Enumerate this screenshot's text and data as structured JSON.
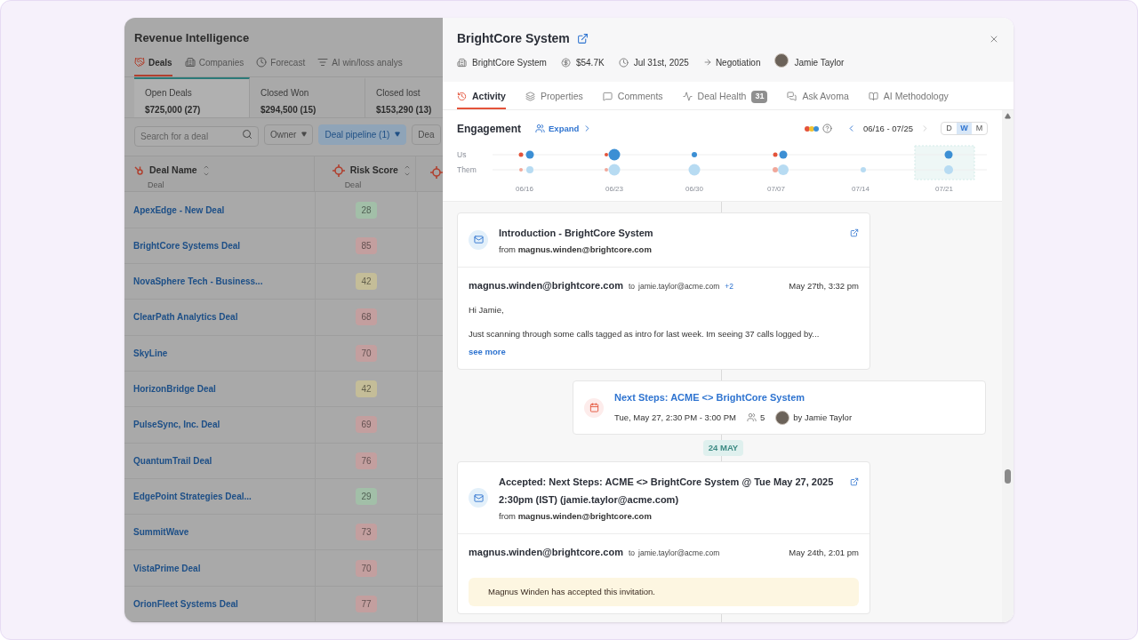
{
  "app": {
    "title": "Revenue Intelligence",
    "tabs": [
      {
        "label": "Deals",
        "selected": true
      },
      {
        "label": "Companies",
        "selected": false
      },
      {
        "label": "Forecast",
        "selected": false
      },
      {
        "label": "AI win/loss analys",
        "selected": false
      }
    ],
    "stats": [
      {
        "label": "Open Deals",
        "value": "$725,000 (27)",
        "selected": true
      },
      {
        "label": "Closed Won",
        "value": "$294,500 (15)",
        "selected": false
      },
      {
        "label": "Closed lost",
        "value": "$153,290 (13)",
        "selected": false
      }
    ],
    "search": {
      "placeholder": "Search for a deal"
    },
    "filters": [
      {
        "label": "Owner",
        "active": false,
        "cut": false
      },
      {
        "label": "Deal pipeline (1)",
        "active": true,
        "cut": false
      },
      {
        "label": "Dea",
        "active": false,
        "cut": true
      }
    ],
    "table": {
      "columns": [
        {
          "title": "Deal Name",
          "subtitle": "Deal"
        },
        {
          "title": "Risk Score",
          "subtitle": "Deal"
        }
      ],
      "rows": [
        {
          "name": "ApexEdge - New Deal",
          "score": "28",
          "color": "#a2bfa8"
        },
        {
          "name": "BrightCore Systems Deal",
          "score": "85",
          "color": "#c39f9f"
        },
        {
          "name": "NovaSphere Tech - Business...",
          "score": "42",
          "color": "#c4bd98"
        },
        {
          "name": "ClearPath Analytics Deal",
          "score": "68",
          "color": "#c39f9f"
        },
        {
          "name": "SkyLine",
          "score": "70",
          "color": "#c39f9f"
        },
        {
          "name": "HorizonBridge Deal",
          "score": "42",
          "color": "#c4bd98"
        },
        {
          "name": "PulseSync, Inc. Deal",
          "score": "69",
          "color": "#c39f9f"
        },
        {
          "name": "QuantumTrail Deal",
          "score": "76",
          "color": "#c39f9f"
        },
        {
          "name": "EdgePoint Strategies Deal...",
          "score": "29",
          "color": "#a2bfa8"
        },
        {
          "name": "SummitWave",
          "score": "73",
          "color": "#c39f9f"
        },
        {
          "name": "VistaPrime Deal",
          "score": "70",
          "color": "#c39f9f"
        },
        {
          "name": "OrionFleet Systems Deal",
          "score": "77",
          "color": "#c39f9f"
        }
      ]
    }
  },
  "deal": {
    "title": "BrightCore System",
    "company": "BrightCore System",
    "amount": "$54.7K",
    "close_date": "Jul 31st, 2025",
    "stage": "Negotiation",
    "owner": "Jamie Taylor",
    "tabs": [
      {
        "label": "Activity",
        "selected": true
      },
      {
        "label": "Properties",
        "selected": false
      },
      {
        "label": "Comments",
        "selected": false
      },
      {
        "label": "Deal Health",
        "badge": "31",
        "selected": false
      },
      {
        "label": "Ask Avoma",
        "selected": false
      },
      {
        "label": "AI Methodology",
        "selected": false
      }
    ],
    "engagement": {
      "title": "Engagement",
      "expand": "Expand",
      "range": "06/16 - 07/25",
      "periods": [
        {
          "label": "D",
          "selected": false
        },
        {
          "label": "W",
          "selected": true
        },
        {
          "label": "M",
          "selected": false
        }
      ],
      "rows": [
        "Us",
        "Them"
      ],
      "dates": [
        "06/16",
        "06/23",
        "06/30",
        "07/07",
        "07/14",
        "07/21"
      ]
    },
    "timeline": [
      {
        "kind": "email",
        "subject": "Introduction - BrightCore System",
        "from_line": "from **magnus.winden@brightcore.com**",
        "sender": "magnus.winden@brightcore.com",
        "to_label": "to",
        "to": "jamie.taylor@acme.com",
        "extra": "+2",
        "time": "May 27th, 3:32 pm",
        "body": [
          "Hi Jamie,",
          "Just scanning through some calls tagged as intro for last week. Im seeing 37 calls logged by..."
        ],
        "more": "see more"
      },
      {
        "kind": "meeting",
        "title": "Next Steps: ACME <> BrightCore System",
        "time": "Tue, May 27, 2:30 PM - 3:00 PM",
        "attendees": "5",
        "by": "by Jamie Taylor"
      },
      {
        "kind": "date",
        "label": "24 MAY"
      },
      {
        "kind": "email",
        "subject": "Accepted: Next Steps: ACME <> BrightCore System @ Tue May 27, 2025 2:30pm (IST) (jamie.taylor@acme.com)",
        "from_line": "from **magnus.winden@brightcore.com**",
        "sender": "magnus.winden@brightcore.com",
        "to_label": "to",
        "to": "jamie.taylor@acme.com",
        "time": "May 24th, 2:01 pm",
        "notice": "Magnus Winden has accepted this invitation."
      }
    ]
  }
}
